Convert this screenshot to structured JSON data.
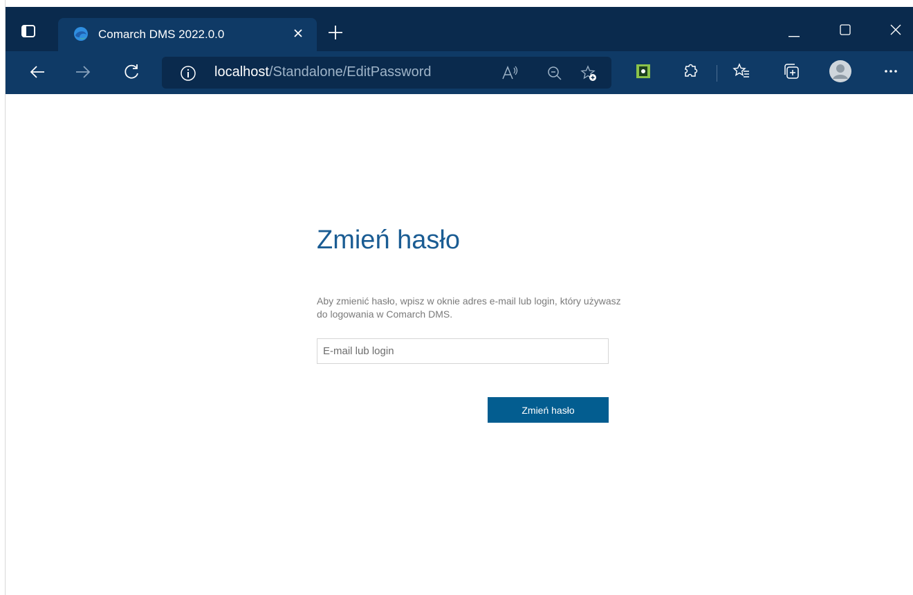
{
  "browser": {
    "tab": {
      "title": "Comarch DMS 2022.0.0"
    },
    "address": {
      "host": "localhost",
      "path": "/Standalone/EditPassword"
    }
  },
  "page": {
    "title": "Zmień hasło",
    "instructions": "Aby zmienić hasło, wpisz w oknie adres e-mail lub login, który używasz do logowania w Comarch DMS.",
    "email_field": {
      "placeholder": "E-mail lub login",
      "value": ""
    },
    "submit_label": "Zmień hasło"
  },
  "colors": {
    "tabstrip": "#0a2a4d",
    "toolbar": "#0f3a66",
    "title": "#1a5c93",
    "button": "#035d90"
  },
  "icons": [
    "tab-actions-icon",
    "edge-favicon-icon",
    "close-icon",
    "plus-icon",
    "minimize-icon",
    "maximize-icon",
    "window-close-icon",
    "back-arrow-icon",
    "forward-arrow-icon",
    "refresh-icon",
    "info-icon",
    "read-aloud-icon",
    "zoom-out-icon",
    "add-favorite-icon",
    "extension-green-icon",
    "extensions-icon",
    "favorites-icon",
    "collections-icon",
    "profile-avatar-icon",
    "more-options-icon"
  ]
}
